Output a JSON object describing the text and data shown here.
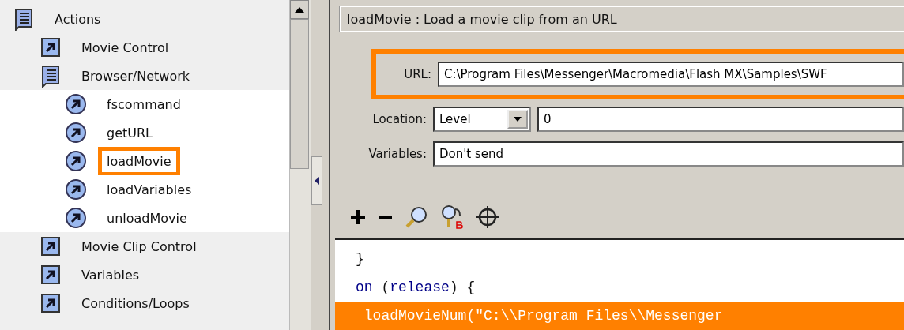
{
  "tree": {
    "label": "Actions",
    "items": [
      {
        "label": "Movie Control",
        "kind": "action",
        "highlighted": false
      },
      {
        "label": "Browser/Network",
        "kind": "book",
        "highlighted": false,
        "children": [
          {
            "label": "fscommand",
            "highlighted": false
          },
          {
            "label": "getURL",
            "highlighted": false
          },
          {
            "label": "loadMovie",
            "highlighted": true
          },
          {
            "label": "loadVariables",
            "highlighted": false
          },
          {
            "label": "unloadMovie",
            "highlighted": false
          }
        ]
      },
      {
        "label": "Movie Clip Control",
        "kind": "action",
        "highlighted": false
      },
      {
        "label": "Variables",
        "kind": "action",
        "highlighted": false
      },
      {
        "label": "Conditions/Loops",
        "kind": "action",
        "highlighted": false
      }
    ]
  },
  "description": "loadMovie : Load a movie clip from an URL",
  "params": [
    {
      "kind": "text",
      "label": "URL:",
      "value": "C:\\Program Files\\Messenger\\Macromedia\\Flash MX\\Samples\\SWF",
      "highlighted": true
    },
    {
      "kind": "select",
      "label": "Location:",
      "option": "Level",
      "value": "0",
      "highlighted": false
    },
    {
      "kind": "text",
      "label": "Variables:",
      "value": "Don't send",
      "highlighted": false
    }
  ],
  "toolbar": [
    {
      "kind": "add"
    },
    {
      "kind": "remove"
    },
    {
      "kind": "find"
    },
    {
      "kind": "replace"
    },
    {
      "kind": "target"
    }
  ],
  "code": [
    {
      "selected": false,
      "segments": [
        {
          "kind": "plain",
          "text": "}"
        }
      ]
    },
    {
      "selected": false,
      "segments": [
        {
          "kind": "keyword",
          "text": "on"
        },
        {
          "kind": "plain",
          "text": " ("
        },
        {
          "kind": "keyword",
          "text": "release"
        },
        {
          "kind": "plain",
          "text": ") {"
        }
      ]
    },
    {
      "selected": true,
      "segments": [
        {
          "kind": "plain",
          "text": " loadMovieNum(\"C:\\\\Program Files\\\\Messenger"
        }
      ]
    }
  ]
}
